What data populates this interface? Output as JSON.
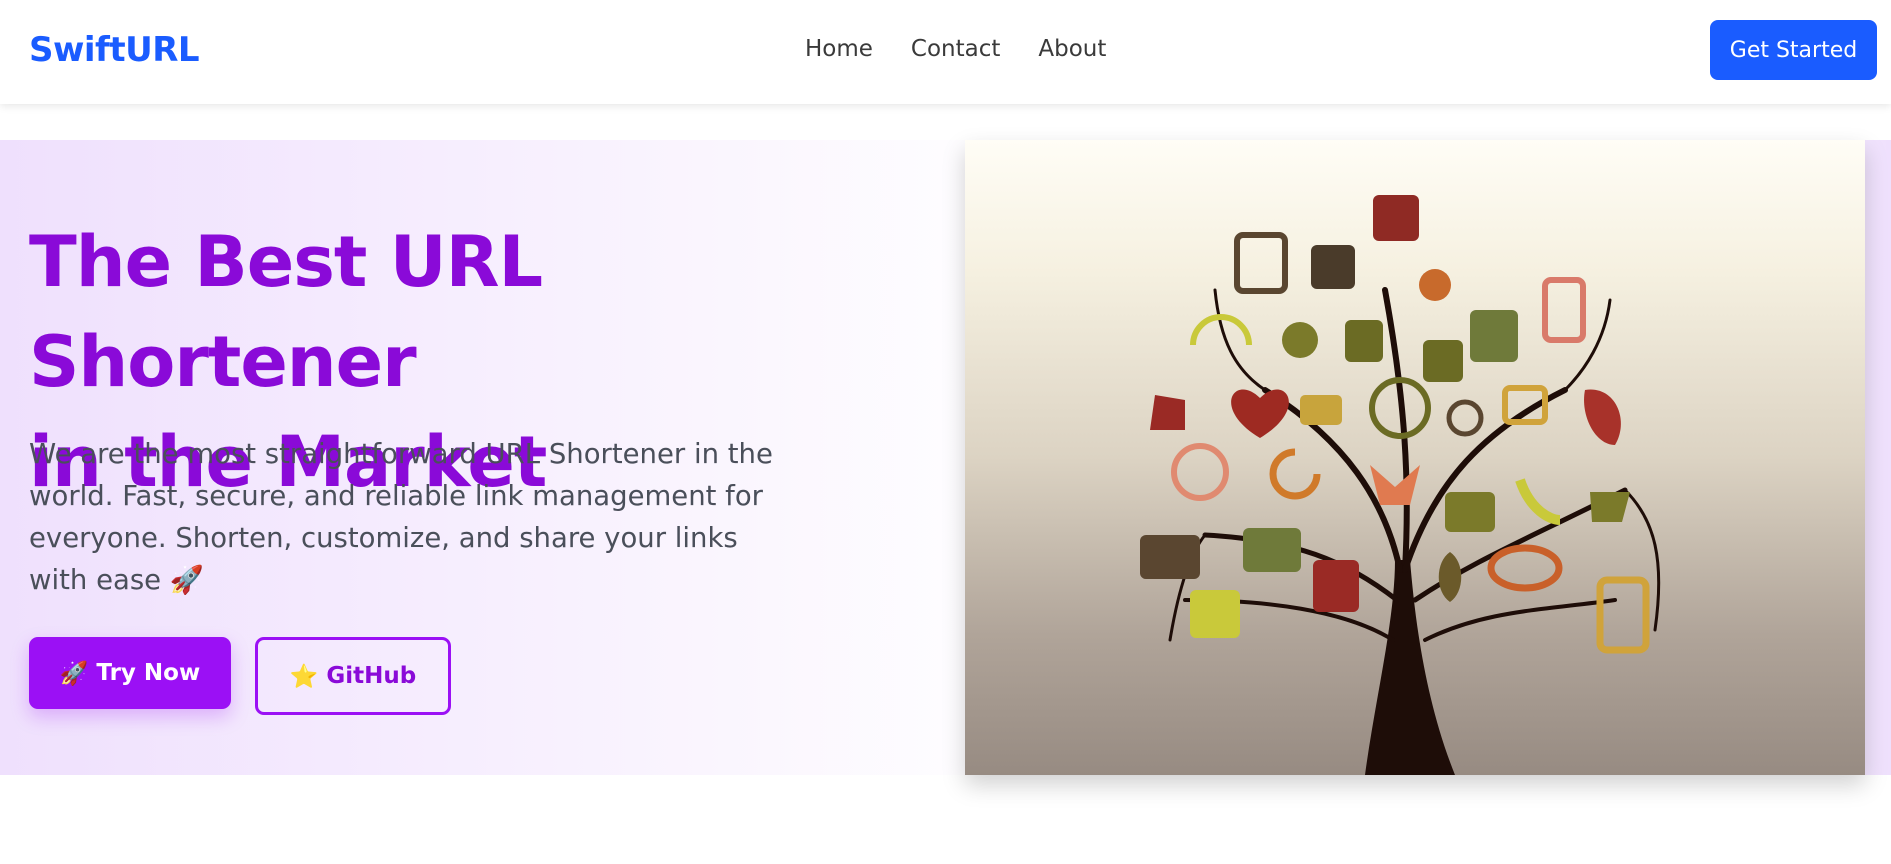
{
  "navbar": {
    "brand": "SwiftURL",
    "links": [
      "Home",
      "Contact",
      "About"
    ],
    "cta": "Get Started"
  },
  "hero": {
    "title_line1": "The Best URL Shortener",
    "title_line2": "in the Market",
    "description": "We are the most straightforward URL Shortener in the world. Fast, secure, and reliable link management for everyone. Shorten, customize, and share your links with ease 🚀",
    "primary_button": {
      "icon": "🚀",
      "label": "Try Now"
    },
    "secondary_button": {
      "icon": "⭐",
      "label": "GitHub"
    },
    "image": {
      "subject": "icon-tree-illustration"
    }
  },
  "colors": {
    "brand_blue": "#1a5cff",
    "hero_purple": "#8a0ad8",
    "button_purple": "#9b10f5"
  }
}
